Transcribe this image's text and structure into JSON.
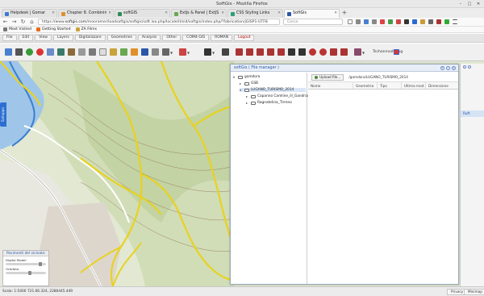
{
  "window": {
    "title": "SoftGis - Mozilla Firefox"
  },
  "tabs": [
    {
      "label": "Helpdesk | Gomar",
      "color": "#3a7bd5",
      "active": false
    },
    {
      "label": "Chapter 8. Combining ma",
      "color": "#e0902a",
      "active": false
    },
    {
      "label": "softGIS",
      "color": "#2e8b57",
      "active": false
    },
    {
      "label": "ExtJs & Panel | ExtJS 6.0",
      "color": "#6aa84f",
      "active": false
    },
    {
      "label": "CSS Styling Links",
      "color": "#2aa07a",
      "active": false
    },
    {
      "label": "SoftGis",
      "color": "#2a56a8",
      "active": true
    }
  ],
  "navbar": {
    "url_prefix": "https://www.",
    "url_domain": "softgis.com",
    "url_rest": "/mooramer/loadsoftgis/softgis/soft.loa.php/locale/it/sid/softgis/index.php/?fabrication/jGISP1-UTF8",
    "search_placeholder": "Cerca"
  },
  "bookmarks": [
    "Most Visited",
    "Getting Started",
    "ZA Films"
  ],
  "app_menu": [
    "File",
    "Edit",
    "View",
    "Layers",
    "Digitalizzare",
    "Geometries",
    "Analysis",
    "Other",
    "COM4-GIS",
    "ROMAN",
    "Logout"
  ],
  "toolbar": {
    "label": "Tschonnvolthing"
  },
  "side_tab": "Sviluppo",
  "legend": {
    "title": "Pavimenti del vicinato",
    "rows": [
      {
        "label": "Digital Model",
        "level": 0.85
      },
      {
        "label": "Ortofoto",
        "level": 0.6
      }
    ]
  },
  "file_manager": {
    "title": "softGis ( File manager )",
    "tree": [
      {
        "label": "gomdora",
        "depth": 0,
        "expanded": true,
        "selected": false
      },
      {
        "label": "GSB",
        "depth": 1,
        "expanded": false,
        "selected": false
      },
      {
        "label": "LUGANO_TURISMO_2014",
        "depth": 1,
        "expanded": true,
        "selected": true
      },
      {
        "label": "Capanno Camline_ill_Gandria",
        "depth": 2,
        "expanded": false,
        "selected": false
      },
      {
        "label": "Ragnatelina_Tirreno",
        "depth": 2,
        "expanded": false,
        "selected": false
      }
    ],
    "upload_label": "Upload file...",
    "current_path": "/gomdora/LUGANO_TURISMO_2014",
    "columns": [
      "Nome",
      "Geometria",
      "Tipo",
      "Ultima mod.",
      "Dimensione"
    ]
  },
  "right_column": {
    "selected_item": "Ruft"
  },
  "status": {
    "scale": "Scala: 1:5400",
    "coords": "721.66.324, 2286445.449",
    "buttons": [
      "Privacy",
      "Minimap"
    ]
  }
}
